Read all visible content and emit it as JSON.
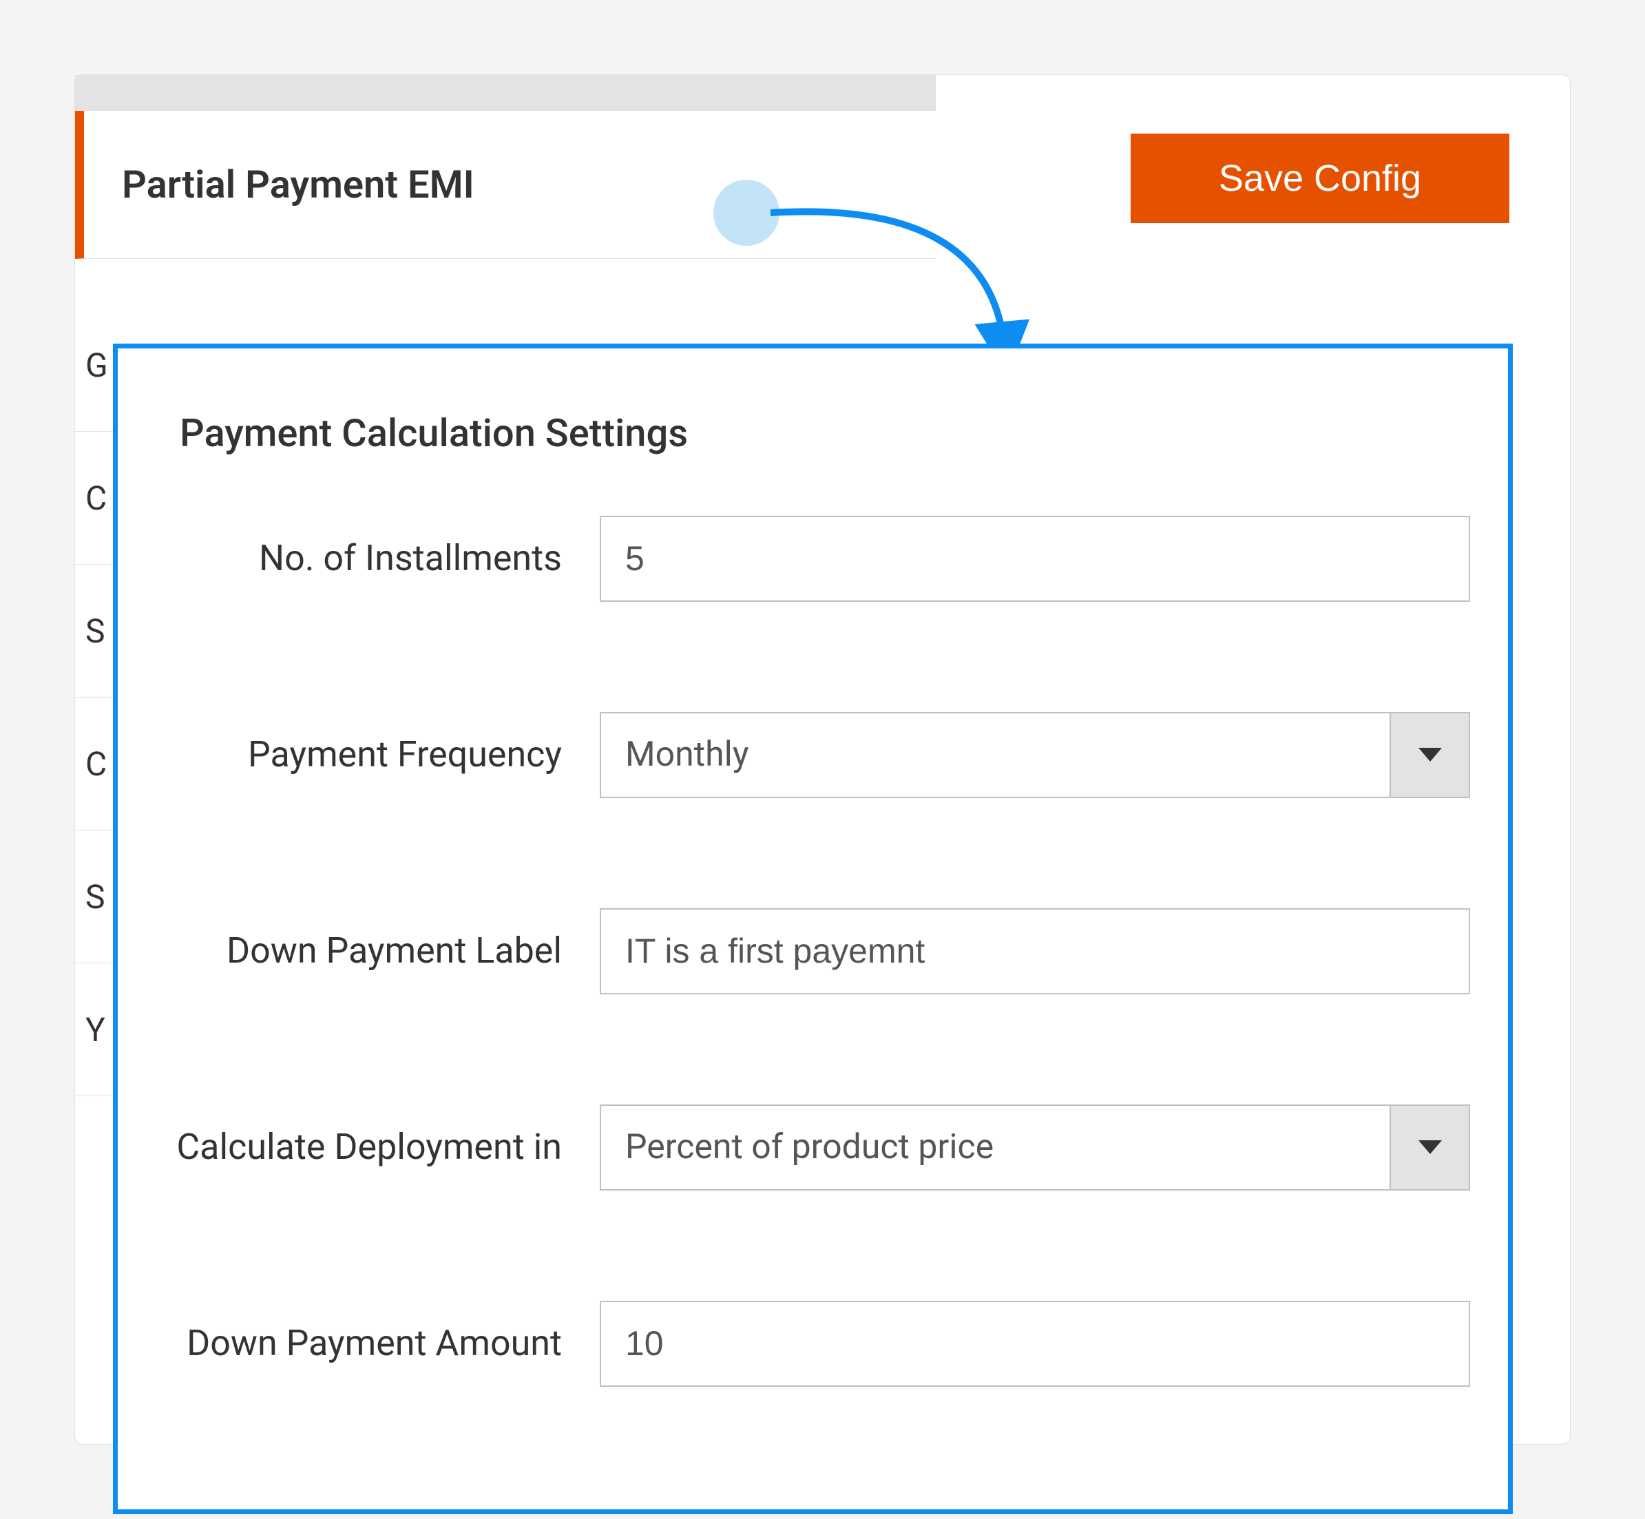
{
  "tab": {
    "title": "Partial Payment EMI"
  },
  "actions": {
    "save_label": "Save Config"
  },
  "sidebar": {
    "items": [
      "G",
      "C",
      "S",
      "C",
      "S",
      "Y"
    ]
  },
  "panel": {
    "title": "Payment Calculation Settings",
    "fields": {
      "installments": {
        "label": "No. of Installments",
        "value": "5"
      },
      "frequency": {
        "label": "Payment Frequency",
        "value": "Monthly"
      },
      "down_label": {
        "label": "Down Payment Label",
        "value": "IT is a first payemnt"
      },
      "calc_deployment": {
        "label": "Calculate Deployment in",
        "value": "Percent of product price"
      },
      "down_amount": {
        "label": "Down Payment Amount",
        "value": "10"
      }
    }
  },
  "colors": {
    "accent": "#e65100",
    "callout_border": "#0d8cf2"
  }
}
